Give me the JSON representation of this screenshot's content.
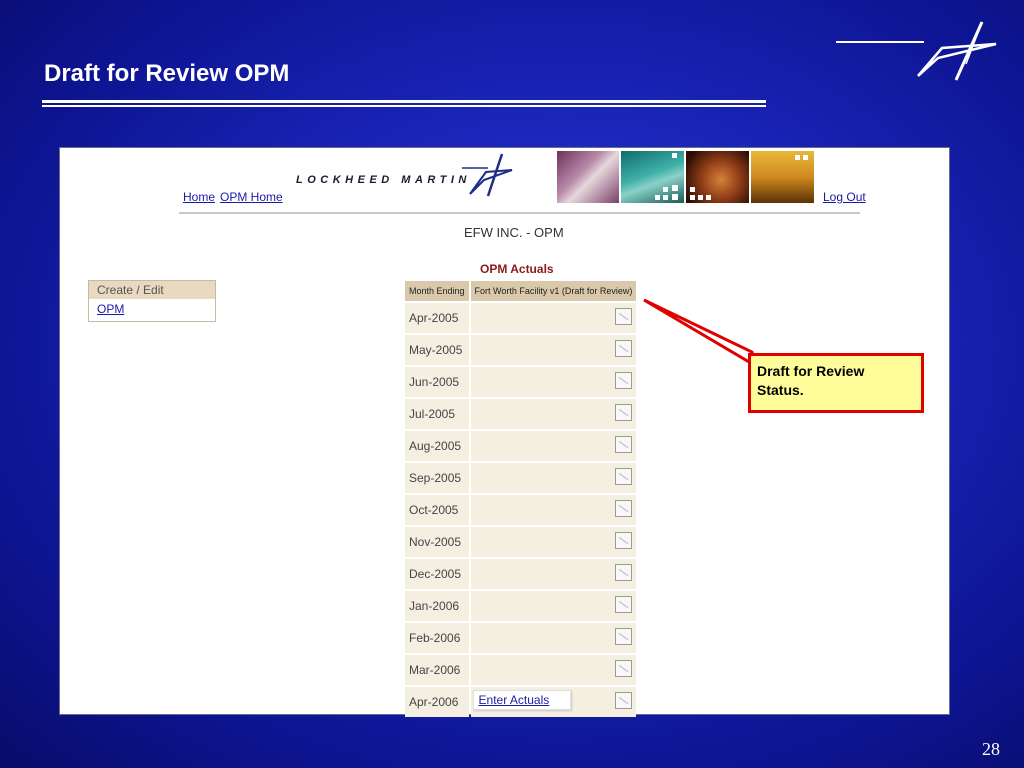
{
  "slide": {
    "title": "Draft for Review OPM",
    "page_number": "28"
  },
  "app": {
    "brand": "LOCKHEED MARTIN",
    "nav": {
      "home": "Home",
      "opm_home": "OPM Home",
      "log_out": "Log Out"
    },
    "company_title": "EFW INC. - OPM",
    "section_title": "OPM Actuals",
    "side_panel": {
      "header": "Create / Edit",
      "items": [
        {
          "label": "OPM"
        }
      ]
    },
    "table": {
      "headers": [
        "Month Ending",
        "Fort Worth Facility v1 (Draft for Review)"
      ],
      "rows": [
        {
          "month": "Apr-2005"
        },
        {
          "month": "May-2005"
        },
        {
          "month": "Jun-2005"
        },
        {
          "month": "Jul-2005"
        },
        {
          "month": "Aug-2005"
        },
        {
          "month": "Sep-2005"
        },
        {
          "month": "Oct-2005"
        },
        {
          "month": "Nov-2005"
        },
        {
          "month": "Dec-2005"
        },
        {
          "month": "Jan-2006"
        },
        {
          "month": "Feb-2006"
        },
        {
          "month": "Mar-2006"
        },
        {
          "month": "Apr-2006",
          "action": "Enter Actuals"
        }
      ]
    }
  },
  "callout": {
    "line1": "Draft for Review",
    "line2": "Status."
  },
  "colors": {
    "callout_border": "#e00000",
    "callout_fill": "#fffd9a",
    "link": "#1a1aa8",
    "header_cell": "#d9c9aa",
    "body_cell": "#f5efe1"
  }
}
